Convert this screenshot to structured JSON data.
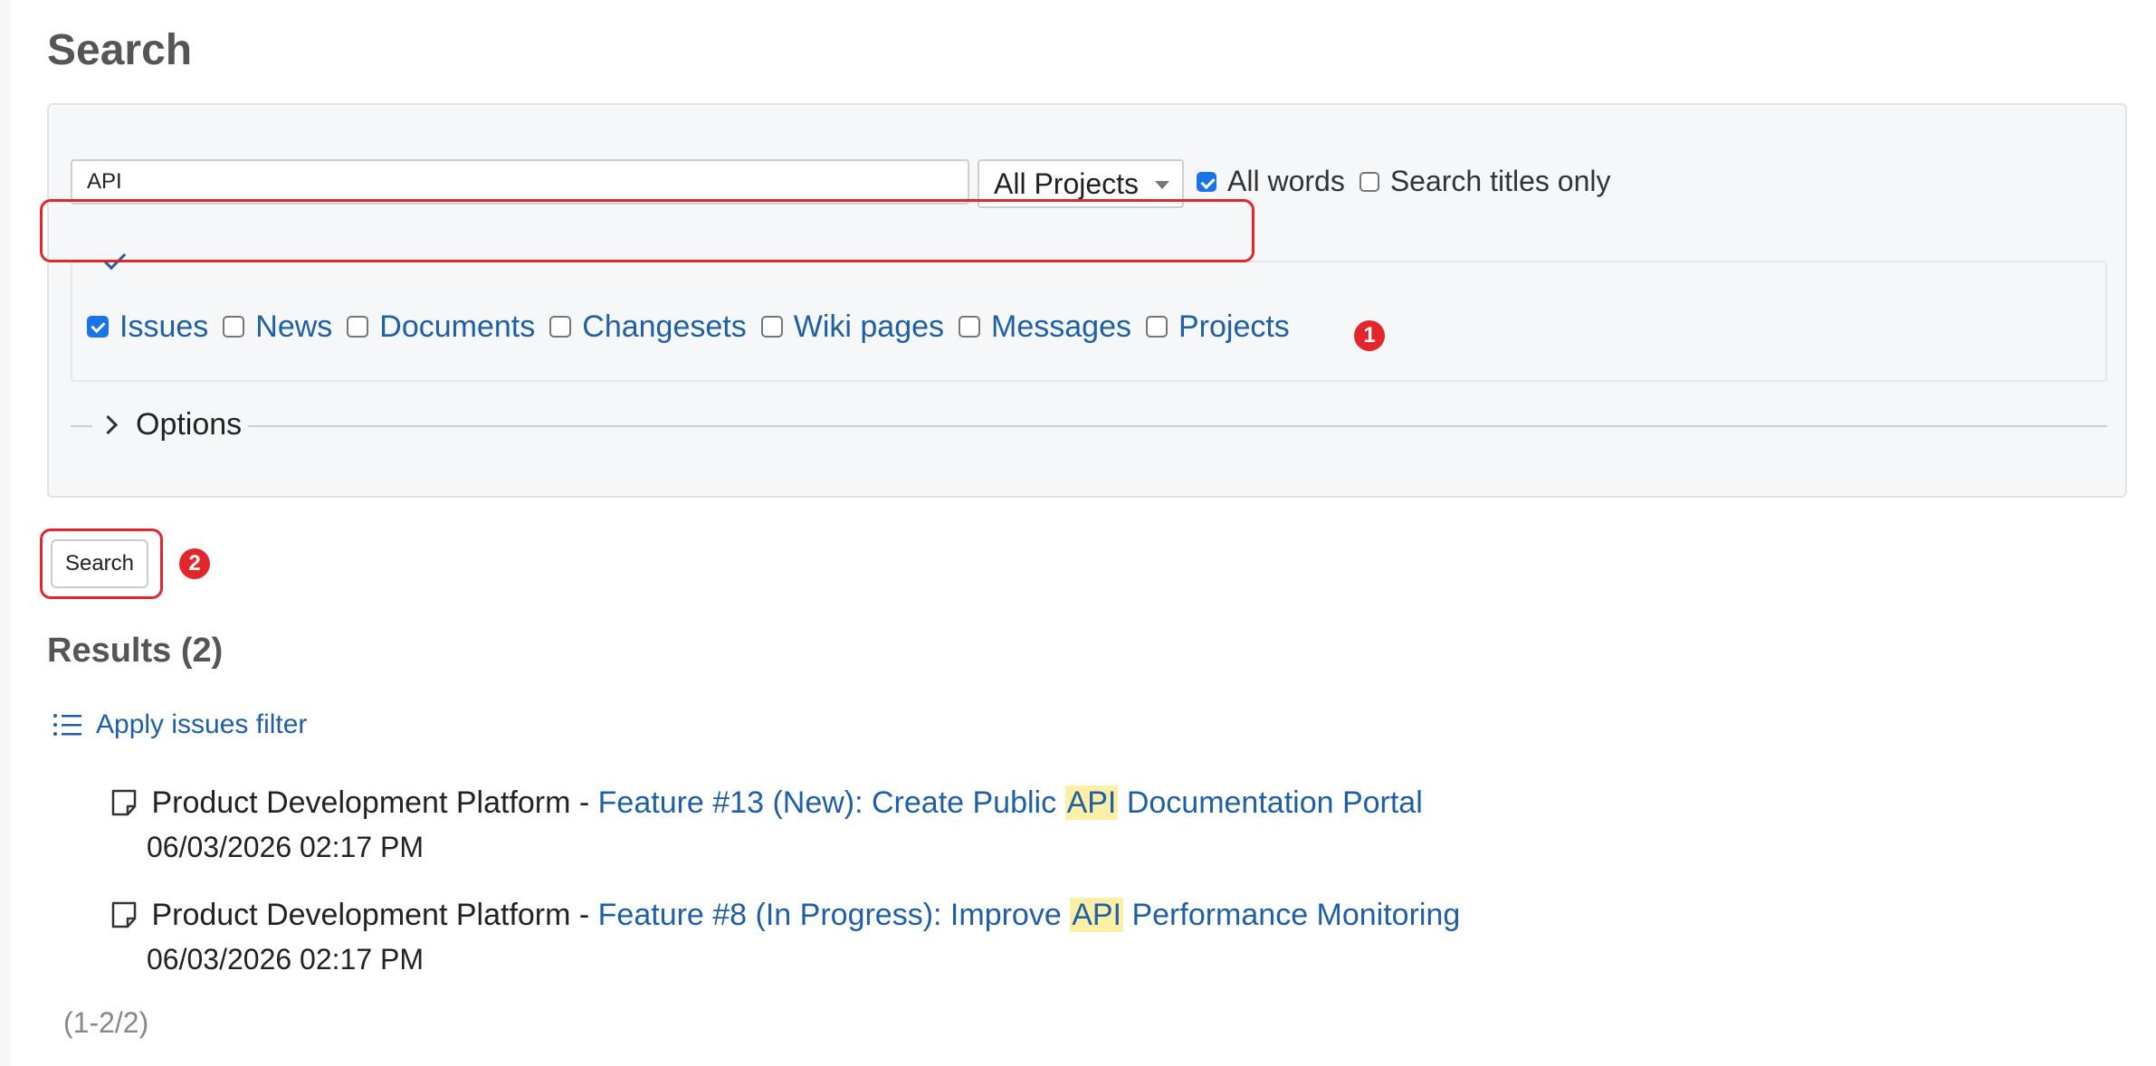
{
  "page_title": "Search",
  "search_form": {
    "query_value": "API",
    "scope_selected": "All Projects",
    "all_words_label": "All words",
    "all_words_checked": true,
    "titles_only_label": "Search titles only",
    "titles_only_checked": false,
    "types": [
      {
        "label": "Issues",
        "checked": true
      },
      {
        "label": "News",
        "checked": false
      },
      {
        "label": "Documents",
        "checked": false
      },
      {
        "label": "Changesets",
        "checked": false
      },
      {
        "label": "Wiki pages",
        "checked": false
      },
      {
        "label": "Messages",
        "checked": false
      },
      {
        "label": "Projects",
        "checked": false
      }
    ],
    "options_label": "Options",
    "submit_label": "Search"
  },
  "annotations": {
    "marker_1": "1",
    "marker_2": "2",
    "highlight_color": "#e3262b"
  },
  "results": {
    "heading": "Results (2)",
    "apply_filter_label": "Apply issues filter",
    "items": [
      {
        "project": "Product Development Platform",
        "separator": " - ",
        "link_prefix": "Feature #13 (New): Create Public ",
        "highlight": "API",
        "link_suffix": " Documentation Portal",
        "datetime": "06/03/2026 02:17 PM"
      },
      {
        "project": "Product Development Platform",
        "separator": " - ",
        "link_prefix": "Feature #8 (In Progress): Improve ",
        "highlight": "API",
        "link_suffix": " Performance Monitoring",
        "datetime": "06/03/2026 02:17 PM"
      }
    ],
    "pagination": "(1-2/2)"
  },
  "colors": {
    "link": "#1f5fa6",
    "heading": "#555555",
    "highlight_bg": "#fdf0a6",
    "checkbox_on": "#1a73e8"
  }
}
